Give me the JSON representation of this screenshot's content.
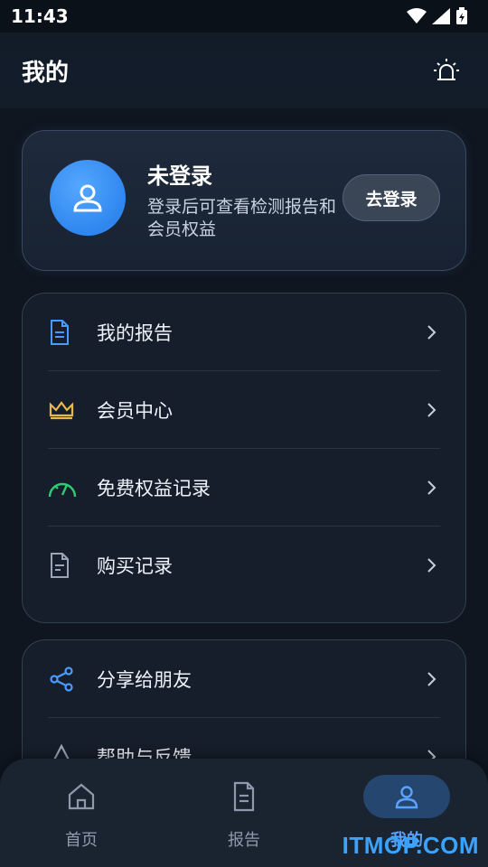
{
  "status_bar": {
    "time": "11:43"
  },
  "header": {
    "title": "我的"
  },
  "profile": {
    "name": "未登录",
    "description": "登录后可查看检测报告和会员权益",
    "login_button": "去登录",
    "avatar_color": "#3a8ef5"
  },
  "menu_group_1": [
    {
      "label": "我的报告",
      "icon": "report-icon",
      "color": "#4a9bff"
    },
    {
      "label": "会员中心",
      "icon": "crown-icon",
      "color": "#e8b84a"
    },
    {
      "label": "免费权益记录",
      "icon": "gauge-icon",
      "color": "#2ecc71"
    },
    {
      "label": "购买记录",
      "icon": "receipt-icon",
      "color": "#9aa6b8"
    }
  ],
  "menu_group_2": [
    {
      "label": "分享给朋友",
      "icon": "share-icon",
      "color": "#4a9bff"
    },
    {
      "label": "帮助与反馈",
      "icon": "help-icon",
      "color": "#9aa6b8"
    }
  ],
  "bottom_nav": [
    {
      "label": "首页",
      "icon": "home-icon"
    },
    {
      "label": "报告",
      "icon": "report-icon"
    },
    {
      "label": "我的",
      "icon": "user-icon",
      "active": true
    }
  ],
  "watermark": "ITMOP.COM",
  "colors": {
    "accent": "#5aa2ff",
    "background": "#0f1620"
  }
}
